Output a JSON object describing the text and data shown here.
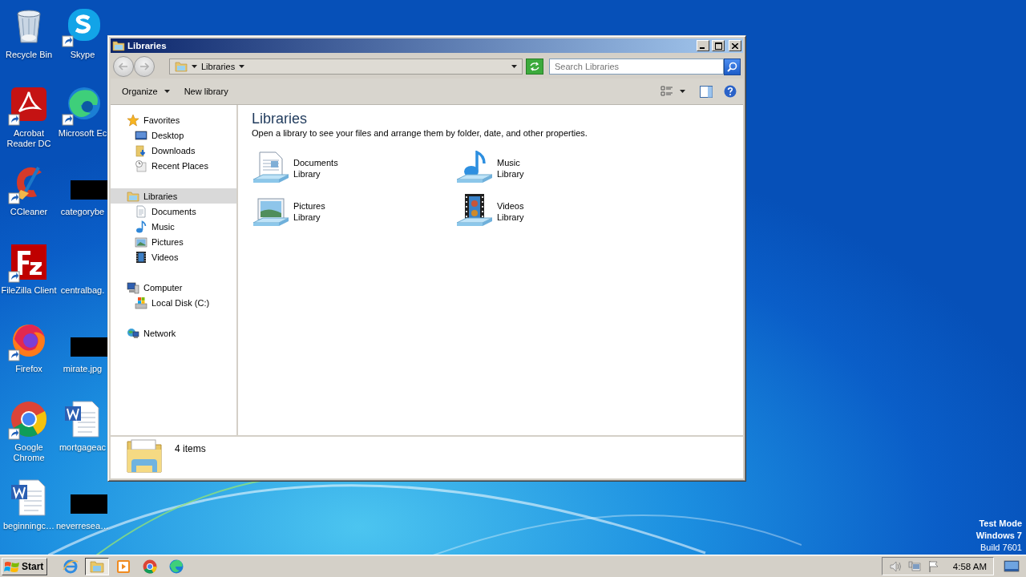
{
  "desktop_icons": [
    {
      "label": "Recycle Bin",
      "kind": "recycle",
      "shortcut": false
    },
    {
      "label": "Skype",
      "kind": "skype",
      "shortcut": true
    },
    {
      "label": "Acrobat Reader DC",
      "kind": "acrobat",
      "shortcut": true
    },
    {
      "label": "Microsoft Ec",
      "kind": "edge",
      "shortcut": true
    },
    {
      "label": "CCleaner",
      "kind": "ccleaner",
      "shortcut": true
    },
    {
      "label": "categorybe",
      "kind": "redacted",
      "shortcut": false
    },
    {
      "label": "FileZilla Client",
      "kind": "filezilla",
      "shortcut": true
    },
    {
      "label": "centralbag.",
      "kind": "blank",
      "shortcut": false
    },
    {
      "label": "Firefox",
      "kind": "firefox",
      "shortcut": true
    },
    {
      "label": "mirate.jpg",
      "kind": "redacted",
      "shortcut": false
    },
    {
      "label": "Google Chrome",
      "kind": "chrome",
      "shortcut": true
    },
    {
      "label": "mortgageac",
      "kind": "word",
      "shortcut": false
    },
    {
      "label": "beginningc…",
      "kind": "word",
      "shortcut": false
    },
    {
      "label": "neverresea…",
      "kind": "redacted",
      "shortcut": false
    }
  ],
  "window": {
    "title": "Libraries",
    "address": "Libraries",
    "search": {
      "placeholder": "Search Libraries"
    },
    "toolbar": [
      {
        "label": "Organize",
        "dropdown": true
      },
      {
        "label": "New library",
        "dropdown": false
      }
    ],
    "nav": [
      {
        "label": "Favorites",
        "kind": "star",
        "selected": false,
        "children": [
          {
            "label": "Desktop",
            "kind": "desktop",
            "selected": false
          },
          {
            "label": "Downloads",
            "kind": "downloads",
            "selected": false
          },
          {
            "label": "Recent Places",
            "kind": "recent",
            "selected": false
          }
        ]
      },
      {
        "label": "Libraries",
        "kind": "library",
        "selected": true,
        "children": [
          {
            "label": "Documents",
            "kind": "documents",
            "selected": false
          },
          {
            "label": "Music",
            "kind": "music",
            "selected": false
          },
          {
            "label": "Pictures",
            "kind": "pictures",
            "selected": false
          },
          {
            "label": "Videos",
            "kind": "videos",
            "selected": false
          }
        ]
      },
      {
        "label": "Computer",
        "kind": "computer",
        "selected": false,
        "children": [
          {
            "label": "Local Disk (C:)",
            "kind": "disk",
            "selected": false
          }
        ]
      },
      {
        "label": "Network",
        "kind": "network",
        "selected": false
      }
    ],
    "heading": "Libraries",
    "description": "Open a library to see your files and arrange them by folder, date, and other properties.",
    "libraries": [
      {
        "name": "Documents",
        "type": "Library",
        "kind": "documents"
      },
      {
        "name": "Music",
        "type": "Library",
        "kind": "music"
      },
      {
        "name": "Pictures",
        "type": "Library",
        "kind": "pictures"
      },
      {
        "name": "Videos",
        "type": "Library",
        "kind": "videos"
      }
    ],
    "status": "4 items"
  },
  "os_notice": [
    {
      "text": "Test Mode",
      "bold": true
    },
    {
      "text": "Windows 7",
      "bold": true
    },
    {
      "text": "Build 7601",
      "bold": false
    }
  ],
  "taskbar": {
    "start": "Start",
    "apps": [
      {
        "kind": "ie",
        "selected": false
      },
      {
        "kind": "explorer",
        "selected": true
      },
      {
        "kind": "player",
        "selected": false
      },
      {
        "kind": "chrome",
        "selected": false
      },
      {
        "kind": "edge",
        "selected": false
      }
    ],
    "time": "4:58 AM"
  }
}
